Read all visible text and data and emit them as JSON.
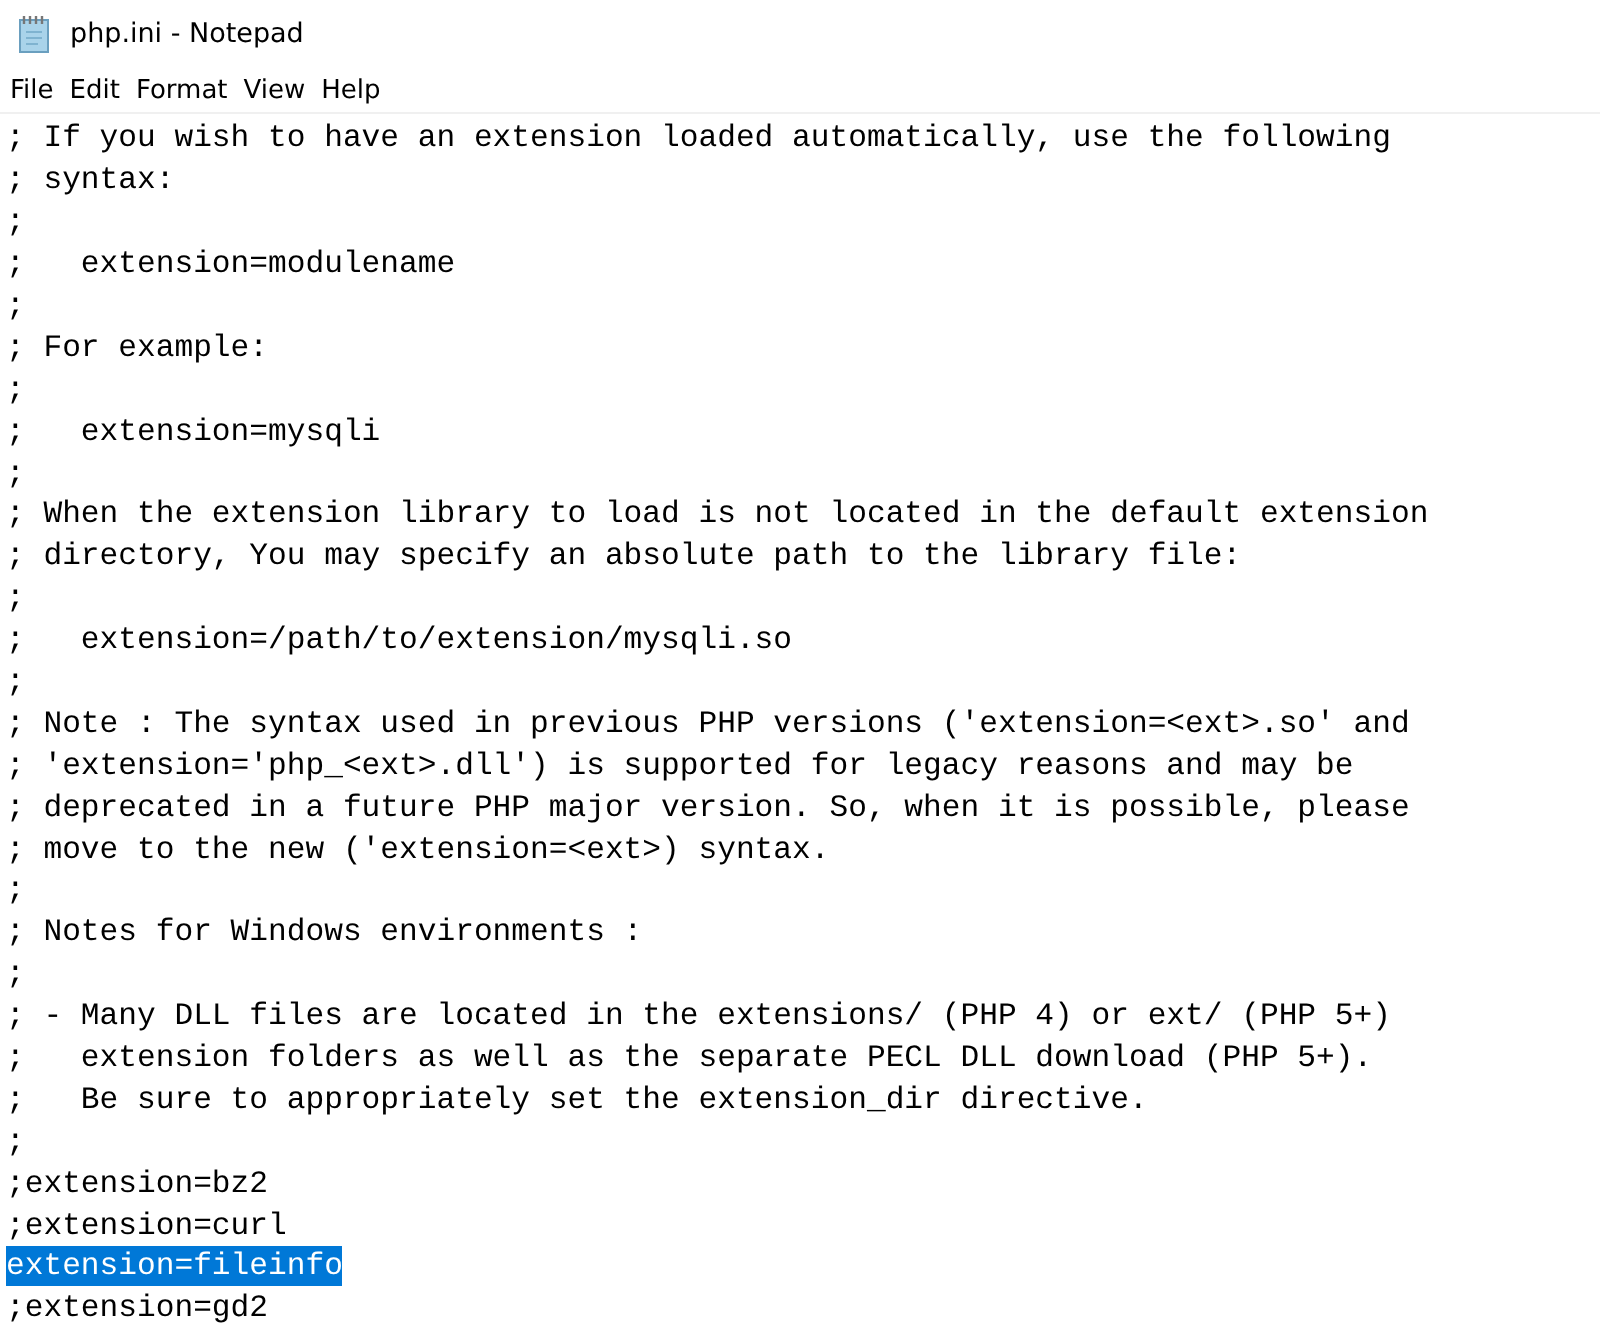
{
  "window": {
    "title": "php.ini - Notepad"
  },
  "menu": [
    "File",
    "Edit",
    "Format",
    "View",
    "Help"
  ],
  "lines": [
    {
      "text": "; If you wish to have an extension loaded automatically, use the following",
      "selected": false
    },
    {
      "text": "; syntax:",
      "selected": false
    },
    {
      "text": ";",
      "selected": false
    },
    {
      "text": ";   extension=modulename",
      "selected": false
    },
    {
      "text": ";",
      "selected": false
    },
    {
      "text": "; For example:",
      "selected": false
    },
    {
      "text": ";",
      "selected": false
    },
    {
      "text": ";   extension=mysqli",
      "selected": false
    },
    {
      "text": ";",
      "selected": false
    },
    {
      "text": "; When the extension library to load is not located in the default extension",
      "selected": false
    },
    {
      "text": "; directory, You may specify an absolute path to the library file:",
      "selected": false
    },
    {
      "text": ";",
      "selected": false
    },
    {
      "text": ";   extension=/path/to/extension/mysqli.so",
      "selected": false
    },
    {
      "text": ";",
      "selected": false
    },
    {
      "text": "; Note : The syntax used in previous PHP versions ('extension=<ext>.so' and",
      "selected": false
    },
    {
      "text": "; 'extension='php_<ext>.dll') is supported for legacy reasons and may be",
      "selected": false
    },
    {
      "text": "; deprecated in a future PHP major version. So, when it is possible, please",
      "selected": false
    },
    {
      "text": "; move to the new ('extension=<ext>) syntax.",
      "selected": false
    },
    {
      "text": ";",
      "selected": false
    },
    {
      "text": "; Notes for Windows environments :",
      "selected": false
    },
    {
      "text": ";",
      "selected": false
    },
    {
      "text": "; - Many DLL files are located in the extensions/ (PHP 4) or ext/ (PHP 5+)",
      "selected": false
    },
    {
      "text": ";   extension folders as well as the separate PECL DLL download (PHP 5+).",
      "selected": false
    },
    {
      "text": ";   Be sure to appropriately set the extension_dir directive.",
      "selected": false
    },
    {
      "text": ";",
      "selected": false
    },
    {
      "text": ";extension=bz2",
      "selected": false
    },
    {
      "text": ";extension=curl",
      "selected": false
    },
    {
      "text": "extension=fileinfo",
      "selected": true
    },
    {
      "text": ";extension=gd2",
      "selected": false
    }
  ]
}
